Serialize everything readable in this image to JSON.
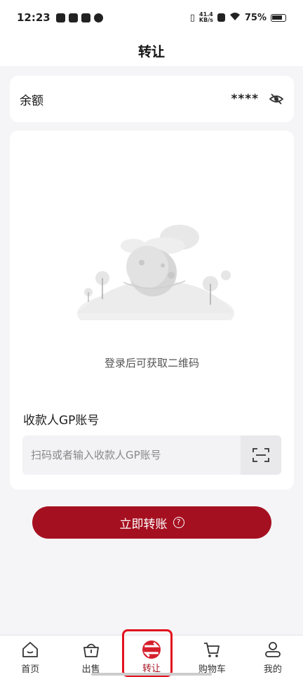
{
  "status_bar": {
    "time": "12:23",
    "net_speed_value": "41.4",
    "net_speed_unit": "KB/s",
    "battery": "75%"
  },
  "header": {
    "title": "转让"
  },
  "balance": {
    "label": "余额",
    "value": "****"
  },
  "main": {
    "qr_hint": "登录后可获取二维码",
    "recipient_label": "收款人GP账号",
    "recipient_placeholder": "扫码或者输入收款人GP账号"
  },
  "transfer_button": {
    "label": "立即转账",
    "help": "?"
  },
  "tabbar": {
    "items": [
      {
        "label": "首页",
        "icon": "home-icon"
      },
      {
        "label": "出售",
        "icon": "sell-basket-icon"
      },
      {
        "label": "转让",
        "icon": "transfer-icon",
        "active": true
      },
      {
        "label": "购物车",
        "icon": "cart-icon"
      },
      {
        "label": "我的",
        "icon": "profile-icon"
      }
    ]
  },
  "colors": {
    "accent": "#a51020",
    "active_icon": "#d61f2c",
    "highlight_border": "#e2121e"
  }
}
